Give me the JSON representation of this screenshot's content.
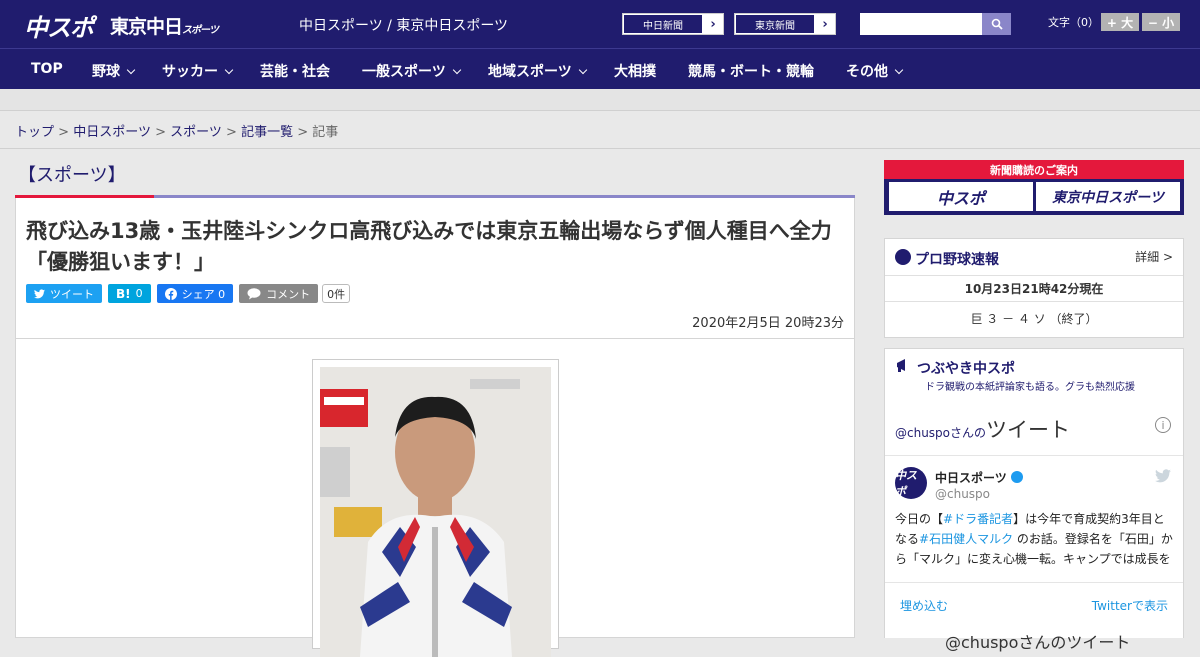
{
  "header": {
    "logo_chuspo": "中スポ",
    "logo_tokyo": "東京中日",
    "logo_tokyo_sub": "スポーツ",
    "site_name": "中日スポーツ / 東京中日スポーツ",
    "paper_links": [
      "中日新聞",
      "東京新聞"
    ],
    "search_placeholder": "",
    "font_size_label": "文字（0）",
    "font_plus": "+ 大",
    "font_minus": "− 小"
  },
  "nav": {
    "items": [
      {
        "label": "TOP"
      },
      {
        "label": "野球"
      },
      {
        "label": "サッカー"
      },
      {
        "label": "芸能・社会"
      },
      {
        "label": "一般スポーツ"
      },
      {
        "label": "地域スポーツ"
      },
      {
        "label": "大相撲"
      },
      {
        "label": "競馬・ボート・競輪"
      },
      {
        "label": "その他"
      }
    ]
  },
  "breadcrumb": {
    "items": [
      "トップ",
      "中日スポーツ",
      "スポーツ",
      "記事一覧"
    ],
    "current": "記事",
    "separator": ">"
  },
  "article": {
    "category": "【スポーツ】",
    "headline": "飛び込み13歳・玉井陸斗シンクロ高飛び込みでは東京五輪出場ならず個人種目へ全力「優勝狙います！」",
    "share": {
      "tweet": "ツイート",
      "hatena_count": "0",
      "facebook": "シェア 0",
      "comment": "コメント",
      "comment_count": "0件"
    },
    "date": "2020年2月5日 20時23分"
  },
  "sidebar": {
    "ad_title": "新聞購読のご案内",
    "ad_left": "中スポ",
    "ad_right": "東京中日スポーツ",
    "baseball": {
      "title": "プロ野球速報",
      "detail": "詳細 >",
      "timestamp": "10月23日21時42分現在",
      "score": "巨 ３ － ４ ソ （終了）"
    },
    "tsubuyaki": {
      "title": "つぶやき中スポ",
      "subtitle": "ドラ観戦の本紙評論家も語る。グラも熱烈応援",
      "handle": "@chuspoさんの",
      "tweet_label": "ツイート",
      "account_name": "中日スポーツ",
      "account_user": "@chuspo",
      "avatar_text": "中スポ",
      "tweet_text_1": "今日の【",
      "tag1": "#ドラ番記者",
      "tweet_text_2": "】は今年で育成契約3年目となる",
      "tag2": "#石田健人マルク",
      "tweet_text_3": " のお話。登録名を「石田」から「マルク」に変え心機一転。キャンプでは成長を実感させるかのように、少しずつ結果が出てきている",
      "embed": "埋め込む",
      "view_on": "Twitterで表示",
      "more": "@chuspoさんのツイート"
    }
  }
}
